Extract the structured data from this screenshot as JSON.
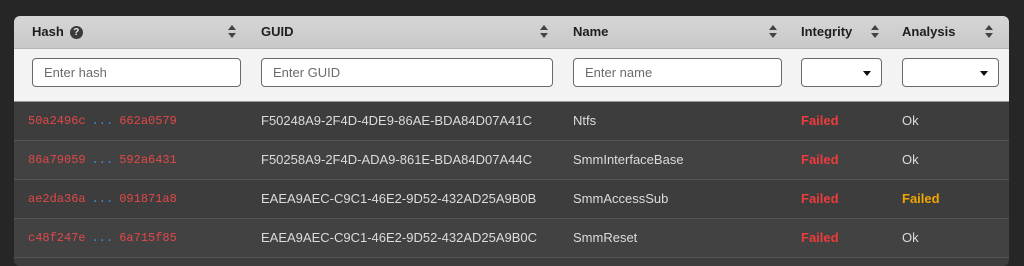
{
  "columns": {
    "hash": "Hash",
    "guid": "GUID",
    "name": "Name",
    "integrity": "Integrity",
    "analysis": "Analysis"
  },
  "help_glyph": "?",
  "filters": {
    "hash_placeholder": "Enter hash",
    "guid_placeholder": "Enter GUID",
    "name_placeholder": "Enter name",
    "integrity_selected": "",
    "analysis_selected": ""
  },
  "hash_separator": "...",
  "rows": [
    {
      "hash_start": "50a2496c",
      "hash_end": "662a0579",
      "guid": "F50248A9-2F4D-4DE9-86AE-BDA84D07A41C",
      "name": "Ntfs",
      "integrity": "Failed",
      "analysis": "Ok"
    },
    {
      "hash_start": "86a79059",
      "hash_end": "592a6431",
      "guid": "F50258A9-2F4D-ADA9-861E-BDA84D07A44C",
      "name": "SmmInterfaceBase",
      "integrity": "Failed",
      "analysis": "Ok"
    },
    {
      "hash_start": "ae2da36a",
      "hash_end": "091871a8",
      "guid": "EAEA9AEC-C9C1-46E2-9D52-432AD25A9B0B",
      "name": "SmmAccessSub",
      "integrity": "Failed",
      "analysis": "Failed"
    },
    {
      "hash_start": "c48f247e",
      "hash_end": "6a715f85",
      "guid": "EAEA9AEC-C9C1-46E2-9D52-432AD25A9B0C",
      "name": "SmmReset",
      "integrity": "Failed",
      "analysis": "Ok"
    }
  ],
  "colors": {
    "failed_integrity": "#ee3b3b",
    "failed_analysis": "#f0a500",
    "hash_text": "#e24848",
    "hash_dots": "#3d8fe0"
  }
}
